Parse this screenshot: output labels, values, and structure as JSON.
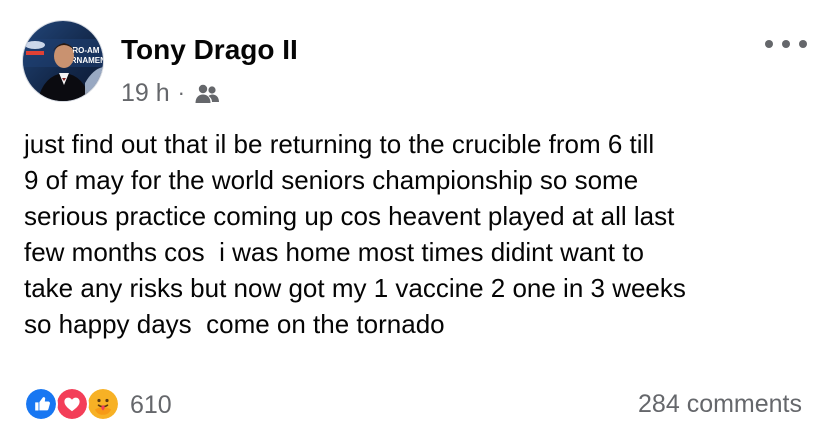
{
  "post": {
    "author": {
      "name": "Tony Drago II",
      "avatar_text": [
        "PRO-AM",
        "URNAMEN"
      ]
    },
    "meta": {
      "time": "19 h",
      "separator": "·",
      "audience_icon": "friends-icon"
    },
    "text": "just find out that il be returning to the crucible from 6 till\n9 of may for the world seniors championship so some\nserious practice coming up cos heavent played at all last\nfew months cos  i was home most times didint want to\ntake any risks but now got my 1 vaccine 2 one in 3 weeks\nso happy days  come on the tornado",
    "reactions": {
      "types": [
        "like-icon",
        "love-icon",
        "care-icon"
      ],
      "count": "610"
    },
    "comments": {
      "label": "284 comments"
    }
  },
  "icons": {
    "more": "more-icon"
  },
  "colors": {
    "text_primary": "#050505",
    "text_secondary": "#65676b",
    "like_blue": "#1877f2",
    "love_red": "#f33e58",
    "care_yellow": "#f7b125"
  }
}
